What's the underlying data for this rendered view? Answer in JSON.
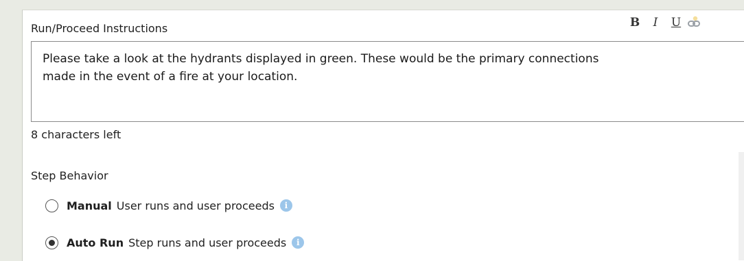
{
  "instructions": {
    "label": "Run/Proceed Instructions",
    "text_line1": "Please take a look at the hydrants displayed in green. These would be the primary connections",
    "text_line2": "made in the event of a fire at your location.",
    "chars_left": "8 characters left"
  },
  "toolbar": {
    "bold": "B",
    "italic": "I",
    "underline": "U",
    "link_icon": "link-icon"
  },
  "step_behavior": {
    "label": "Step Behavior",
    "options": [
      {
        "title": "Manual",
        "description": "User runs and user proceeds",
        "selected": false
      },
      {
        "title": "Auto Run",
        "description": "Step runs and user proceeds",
        "selected": true
      }
    ]
  },
  "colors": {
    "background": "#e9ebe4",
    "panel": "#ffffff",
    "info_icon": "#9cc6ea",
    "border": "#8a8a8a"
  }
}
